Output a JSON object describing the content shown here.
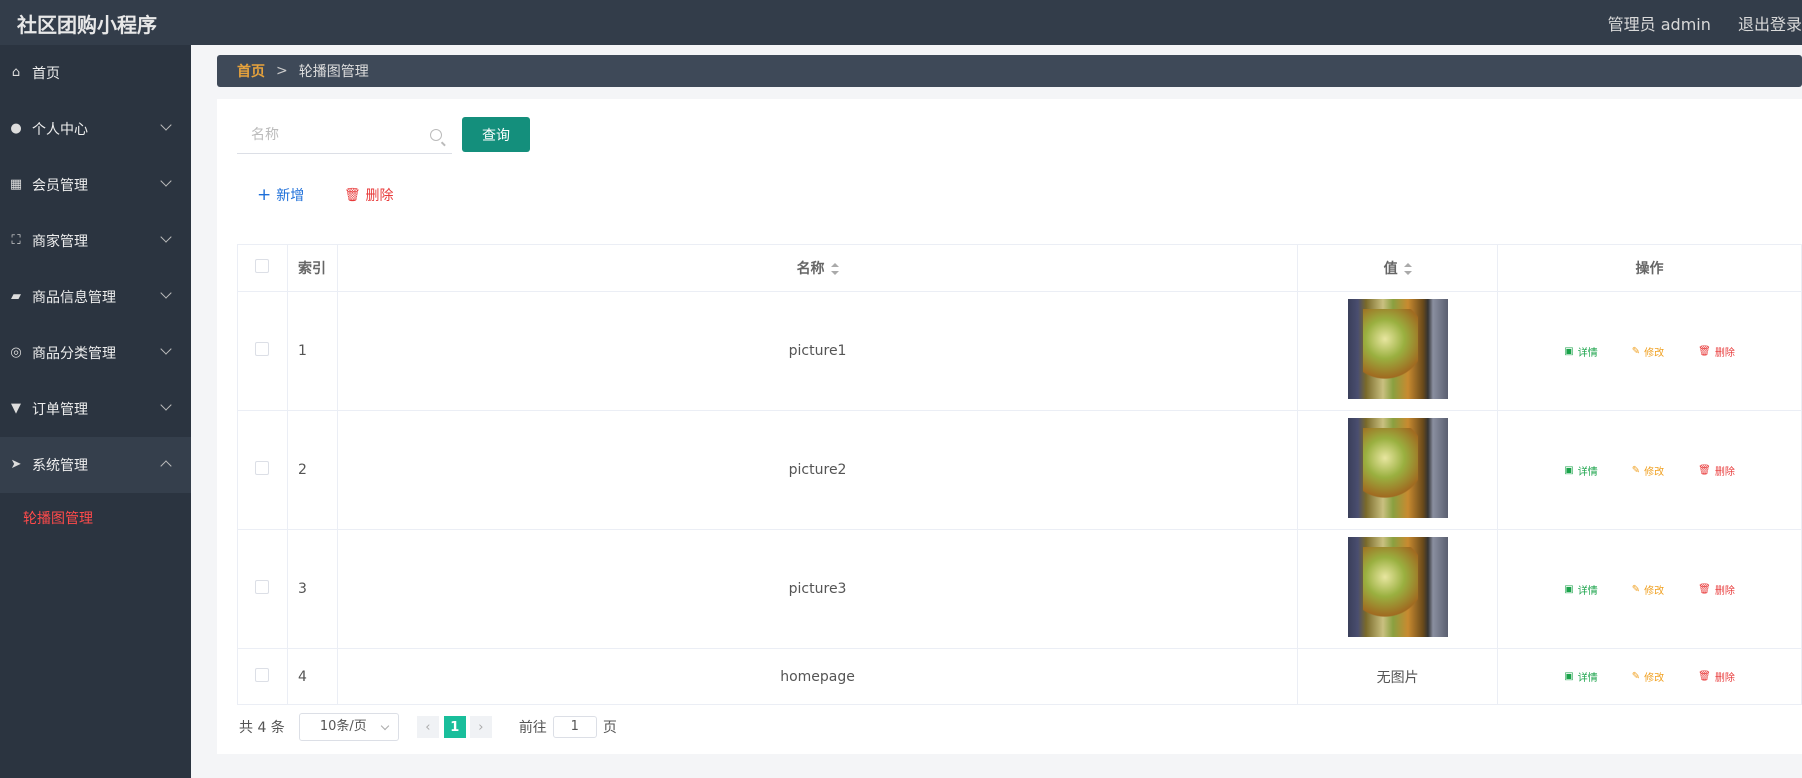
{
  "app": {
    "title": "社区团购小程序"
  },
  "topbar": {
    "user": "管理员 admin",
    "logout": "退出登录"
  },
  "sidebar": {
    "items": [
      {
        "label": "首页",
        "icon": "home-icon"
      },
      {
        "label": "个人中心",
        "icon": "user-icon"
      },
      {
        "label": "会员管理",
        "icon": "grid-icon"
      },
      {
        "label": "商家管理",
        "icon": "frame-icon"
      },
      {
        "label": "商品信息管理",
        "icon": "wallet-icon"
      },
      {
        "label": "商品分类管理",
        "icon": "compass-icon"
      },
      {
        "label": "订单管理",
        "icon": "stamp-icon"
      },
      {
        "label": "系统管理",
        "icon": "send-icon"
      }
    ],
    "submenu": {
      "label": "轮播图管理"
    }
  },
  "breadcrumb": {
    "home": "首页",
    "sep": ">",
    "current": "轮播图管理"
  },
  "search": {
    "placeholder": "名称",
    "button": "查询"
  },
  "actions": {
    "add": "新增",
    "delete": "删除"
  },
  "table": {
    "headers": {
      "index": "索引",
      "name": "名称",
      "value": "值",
      "ops": "操作"
    },
    "rows": [
      {
        "index": "1",
        "name": "picture1",
        "has_image": true
      },
      {
        "index": "2",
        "name": "picture2",
        "has_image": true
      },
      {
        "index": "3",
        "name": "picture3",
        "has_image": true
      },
      {
        "index": "4",
        "name": "homepage",
        "has_image": false,
        "value_text": "无图片"
      }
    ],
    "op_labels": {
      "detail": "详情",
      "edit": "修改",
      "delete": "删除"
    }
  },
  "pagination": {
    "total": "共 4 条",
    "page_size": "10条/页",
    "current": "1",
    "goto_label": "前往",
    "goto_value": "1",
    "page_suffix": "页"
  },
  "colors": {
    "accent": "#148f7c",
    "topbar": "#333d4a",
    "sidebar": "#2b3440",
    "active": "#ff4a4a"
  }
}
